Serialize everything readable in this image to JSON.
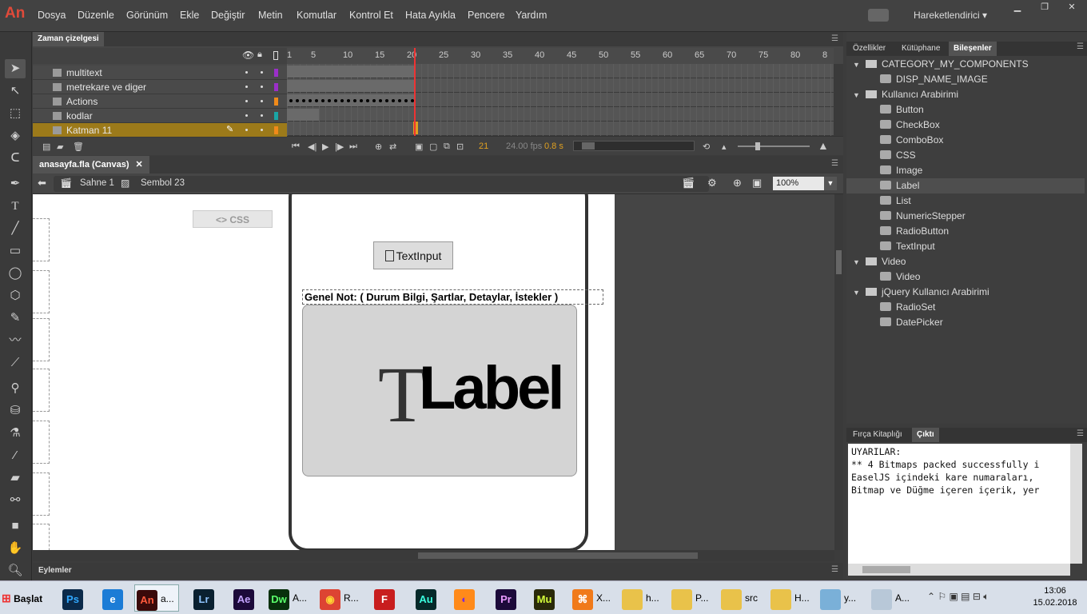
{
  "menubar": {
    "logo": "An",
    "items": [
      "Dosya",
      "Düzenle",
      "Görünüm",
      "Ekle",
      "Değiştir",
      "Metin",
      "Komutlar",
      "Kontrol Et",
      "Hata Ayıkla",
      "Pencere",
      "Yardım"
    ],
    "workspace": "Hareketlendirici"
  },
  "timeline": {
    "tab": "Zaman çizelgesi",
    "layers": [
      "multitext",
      "metrekare ve diger",
      "Actions",
      "kodlar",
      "Katman 11"
    ],
    "ruler": [
      "1",
      "5",
      "10",
      "15",
      "20",
      "25",
      "30",
      "35",
      "40",
      "45",
      "50",
      "55",
      "60",
      "65",
      "70",
      "75",
      "80",
      "8"
    ],
    "current_frame": "21",
    "fps": "24.00 fps",
    "time": "0.8 s"
  },
  "document": {
    "tab": "anasayfa.fla (Canvas)",
    "scene": "Sahne 1",
    "symbol": "Sembol 23",
    "zoom": "100%"
  },
  "stage": {
    "css_button": "<> CSS",
    "textinput": "TextInput",
    "note": "Genel Not: ( Durum Bilgi, Şartlar, Detaylar, İstekler )",
    "label_t": "T",
    "label_text": "Label"
  },
  "actions_panel": "Eylemler",
  "right_tabs": [
    "Özellikler",
    "Kütüphane",
    "Bileşenler"
  ],
  "components": [
    {
      "label": "CATEGORY_MY_COMPONENTS",
      "level": 0,
      "folder": true
    },
    {
      "label": "DISP_NAME_IMAGE",
      "level": 1
    },
    {
      "label": "Kullanıcı Arabirimi",
      "level": 0,
      "folder": true
    },
    {
      "label": "Button",
      "level": 1
    },
    {
      "label": "CheckBox",
      "level": 1
    },
    {
      "label": "ComboBox",
      "level": 1
    },
    {
      "label": "CSS",
      "level": 1
    },
    {
      "label": "Image",
      "level": 1
    },
    {
      "label": "Label",
      "level": 1
    },
    {
      "label": "List",
      "level": 1
    },
    {
      "label": "NumericStepper",
      "level": 1
    },
    {
      "label": "RadioButton",
      "level": 1
    },
    {
      "label": "TextInput",
      "level": 1
    },
    {
      "label": "Video",
      "level": 0,
      "folder": true
    },
    {
      "label": "Video",
      "level": 1
    },
    {
      "label": "jQuery Kullanıcı Arabirimi",
      "level": 0,
      "folder": true
    },
    {
      "label": "RadioSet",
      "level": 1
    },
    {
      "label": "DatePicker",
      "level": 1
    }
  ],
  "output_tabs": [
    "Fırça Kitaplığı",
    "Çıktı"
  ],
  "output_text": "UYARILAR:\n** 4 Bitmaps packed successfully i\nEaselJS içindeki kare numaraları,\nBitmap ve Düğme içeren içerik, yer",
  "taskbar": {
    "start": "Başlat",
    "items": [
      {
        "icon": "Ps",
        "label": "",
        "color": "#0b2a4a",
        "fg": "#31a8ff"
      },
      {
        "icon": "e",
        "label": "",
        "color": "#1c7cd6",
        "fg": "#fff"
      },
      {
        "icon": "An",
        "label": "a...",
        "color": "#3a0a0a",
        "fg": "#ff5a3c"
      },
      {
        "icon": "Lr",
        "label": "",
        "color": "#0a2030",
        "fg": "#8fc4ff"
      },
      {
        "icon": "Ae",
        "label": "",
        "color": "#1c0a3a",
        "fg": "#c4a4ff"
      },
      {
        "icon": "Dw",
        "label": "A...",
        "color": "#08300c",
        "fg": "#5aff6a"
      },
      {
        "icon": "◉",
        "label": "R...",
        "color": "#dd4433",
        "fg": "#ffd433"
      },
      {
        "icon": "F",
        "label": "",
        "color": "#c81e1e",
        "fg": "#fff"
      },
      {
        "icon": "Au",
        "label": "",
        "color": "#062a2a",
        "fg": "#3affe0"
      },
      {
        "icon": "◐",
        "label": "",
        "color": "#ff8a1a",
        "fg": "#7a2adb"
      },
      {
        "icon": "Pr",
        "label": "",
        "color": "#1c0a3a",
        "fg": "#e89aff"
      },
      {
        "icon": "Mu",
        "label": "",
        "color": "#2a2a0a",
        "fg": "#d4ff3a"
      },
      {
        "icon": "⌘",
        "label": "X...",
        "color": "#f07a1a",
        "fg": "#fff"
      },
      {
        "icon": "",
        "label": "h...",
        "color": "#e9c24a",
        "fg": "#000"
      },
      {
        "icon": "",
        "label": "P...",
        "color": "#e9c24a",
        "fg": "#000"
      },
      {
        "icon": "",
        "label": "src",
        "color": "#e9c24a",
        "fg": "#000"
      },
      {
        "icon": "",
        "label": "H...",
        "color": "#e9c24a",
        "fg": "#000"
      },
      {
        "icon": "",
        "label": "y...",
        "color": "#7ab0d8",
        "fg": "#000"
      },
      {
        "icon": "",
        "label": "A...",
        "color": "#b8c8d8",
        "fg": "#000"
      }
    ],
    "time": "13:06",
    "date": "15.02.2018"
  },
  "colors": {
    "accent": "#9c7a1a",
    "playhead": "#e33333"
  }
}
